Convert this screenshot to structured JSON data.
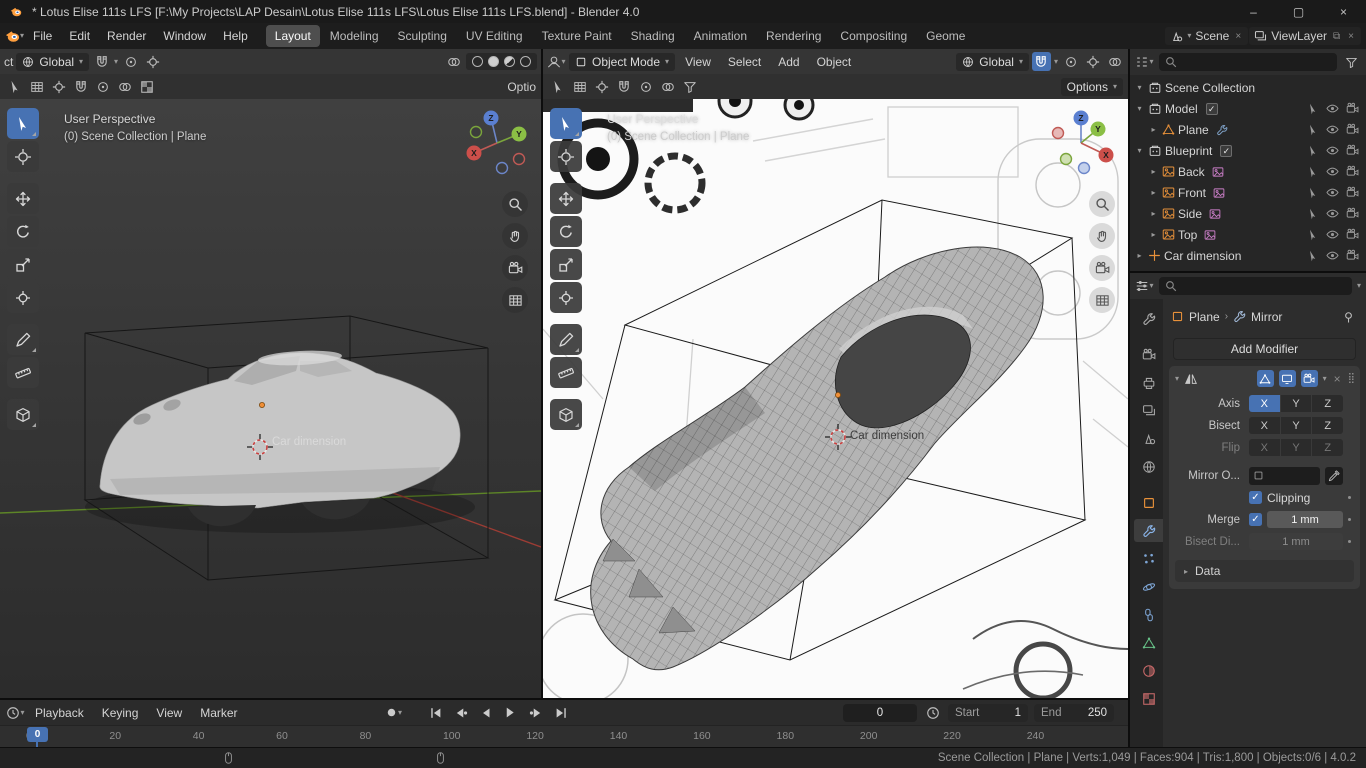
{
  "window": {
    "title": "* Lotus Elise 111s LFS [F:\\My Projects\\LAP Desain\\Lotus Elise 111s LFS\\Lotus Elise 111s LFS.blend] - Blender 4.0"
  },
  "topbar": {
    "menus": [
      "File",
      "Edit",
      "Render",
      "Window",
      "Help"
    ],
    "active_workspace": "Layout",
    "workspaces_rest": [
      "Modeling",
      "Sculpting",
      "UV Editing",
      "Texture Paint",
      "Shading",
      "Animation",
      "Rendering",
      "Compositing",
      "Geome"
    ],
    "scene_name": "Scene",
    "viewlayer_name": "ViewLayer"
  },
  "viewport_left": {
    "header_mode_truncated": "ct",
    "orientation": "Global",
    "options_truncated": "Optio",
    "overlay": {
      "line1": "User Perspective",
      "line2": "(0) Scene Collection | Plane"
    },
    "cursor_label": "Car dimension"
  },
  "viewport_right": {
    "mode": "Object Mode",
    "menus": [
      "View",
      "Select",
      "Add",
      "Object"
    ],
    "orientation": "Global",
    "options": "Options",
    "overlay": {
      "line1": "User Perspective",
      "line2": "(0) Scene Collection | Plane"
    },
    "cursor_label": "Car dimension"
  },
  "gizmo": {
    "x": "X",
    "y": "Y",
    "z": "Z"
  },
  "outliner": {
    "rows": [
      {
        "label": "Scene Collection"
      },
      {
        "label": "Model"
      },
      {
        "label": "Plane"
      },
      {
        "label": "Blueprint"
      },
      {
        "label": "Back"
      },
      {
        "label": "Front"
      },
      {
        "label": "Side"
      },
      {
        "label": "Top"
      },
      {
        "label": "Car dimension"
      }
    ]
  },
  "properties": {
    "breadcrumb": {
      "object": "Plane",
      "modifier": "Mirror"
    },
    "add_modifier_label": "Add Modifier",
    "modifier": {
      "axis_label": "Axis",
      "bisect_label": "Bisect",
      "flip_label": "Flip",
      "axes": [
        "X",
        "Y",
        "Z"
      ],
      "mirror_object_label": "Mirror O...",
      "clipping_label": "Clipping",
      "merge_label": "Merge",
      "merge_value": "1 mm",
      "bisect_distance_label": "Bisect Di...",
      "bisect_distance_value": "1 mm",
      "data_label": "Data"
    }
  },
  "timeline": {
    "menus": [
      "Playback",
      "Keying",
      "View",
      "Marker"
    ],
    "frame_value": "0",
    "start_label": "Start",
    "start_value": "1",
    "end_label": "End",
    "end_value": "250",
    "ticks": [
      "0",
      "20",
      "40",
      "60",
      "80",
      "100",
      "120",
      "140",
      "160",
      "180",
      "200",
      "220",
      "240"
    ],
    "playhead": "0"
  },
  "statusbar": {
    "info": "Scene Collection | Plane | Verts:1,049 | Faces:904 | Tris:1,800 | Objects:0/6 | 4.0.2"
  }
}
